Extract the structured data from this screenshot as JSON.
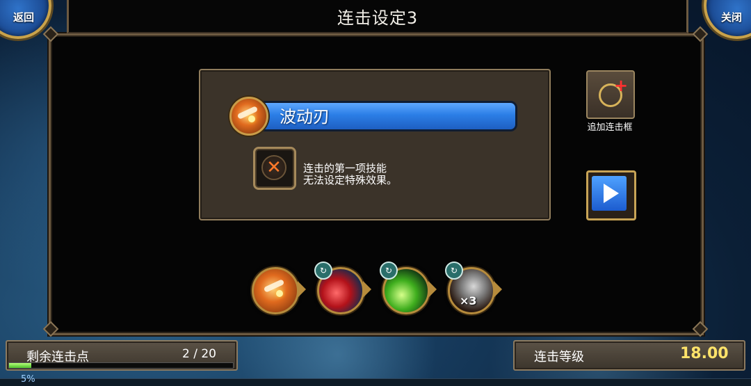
{
  "header": {
    "title": "连击设定3",
    "back_label": "返回",
    "close_label": "关闭"
  },
  "skill_card": {
    "skill_name": "波动刃",
    "info_line1": "连击的第一项技能",
    "info_line2": "无法设定特殊效果。",
    "x_symbol": "✕"
  },
  "side_buttons": {
    "add_frame_label": "追加连击框",
    "add_plus": "+"
  },
  "combo_chain": {
    "items": [
      {
        "name": "wave-blade-skill",
        "badge": ""
      },
      {
        "name": "red-slash-skill",
        "badge": "↻"
      },
      {
        "name": "green-slash-skill",
        "badge": "↻"
      },
      {
        "name": "triple-slash-skill",
        "badge": "↻",
        "multiplier": "×3"
      }
    ]
  },
  "status": {
    "remaining_label": "剩余连击点",
    "remaining_value": "2 / 20",
    "remaining_fraction": 0.1,
    "level_label": "连击等级",
    "level_value": "18.00",
    "bottom_percent_fragment": "5%"
  },
  "colors": {
    "accent_blue": "#2b7ee6",
    "gold_border": "#c9a24a",
    "level_yellow": "#ffe36a",
    "progress_green": "#4bbf2a"
  }
}
